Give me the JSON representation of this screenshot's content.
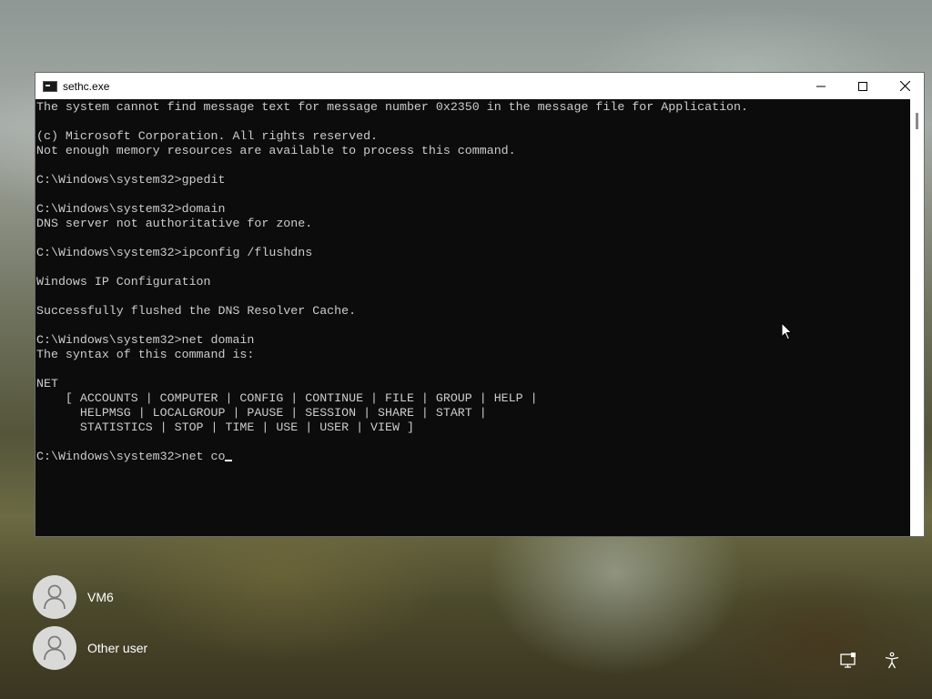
{
  "window": {
    "title": "sethc.exe",
    "icon": "cmd-icon",
    "controls": [
      "minimize-icon",
      "maximize-icon",
      "close-icon"
    ]
  },
  "console": {
    "lines": [
      "The system cannot find message text for message number 0x2350 in the message file for Application.",
      "",
      "(c) Microsoft Corporation. All rights reserved.",
      "Not enough memory resources are available to process this command.",
      "",
      "C:\\Windows\\system32>gpedit",
      "",
      "C:\\Windows\\system32>domain",
      "DNS server not authoritative for zone.",
      "",
      "C:\\Windows\\system32>ipconfig /flushdns",
      "",
      "Windows IP Configuration",
      "",
      "Successfully flushed the DNS Resolver Cache.",
      "",
      "C:\\Windows\\system32>net domain",
      "The syntax of this command is:",
      "",
      "NET",
      "    [ ACCOUNTS | COMPUTER | CONFIG | CONTINUE | FILE | GROUP | HELP |",
      "      HELPMSG | LOCALGROUP | PAUSE | SESSION | SHARE | START |",
      "      STATISTICS | STOP | TIME | USE | USER | VIEW ]",
      ""
    ],
    "prompt": "C:\\Windows\\system32>net co"
  },
  "users": [
    {
      "name": "VM6",
      "icon": "user-avatar-icon"
    },
    {
      "name": "Other user",
      "icon": "user-avatar-icon"
    }
  ],
  "tray": {
    "network_icon": "network-icon",
    "accessibility_icon": "accessibility-icon"
  }
}
